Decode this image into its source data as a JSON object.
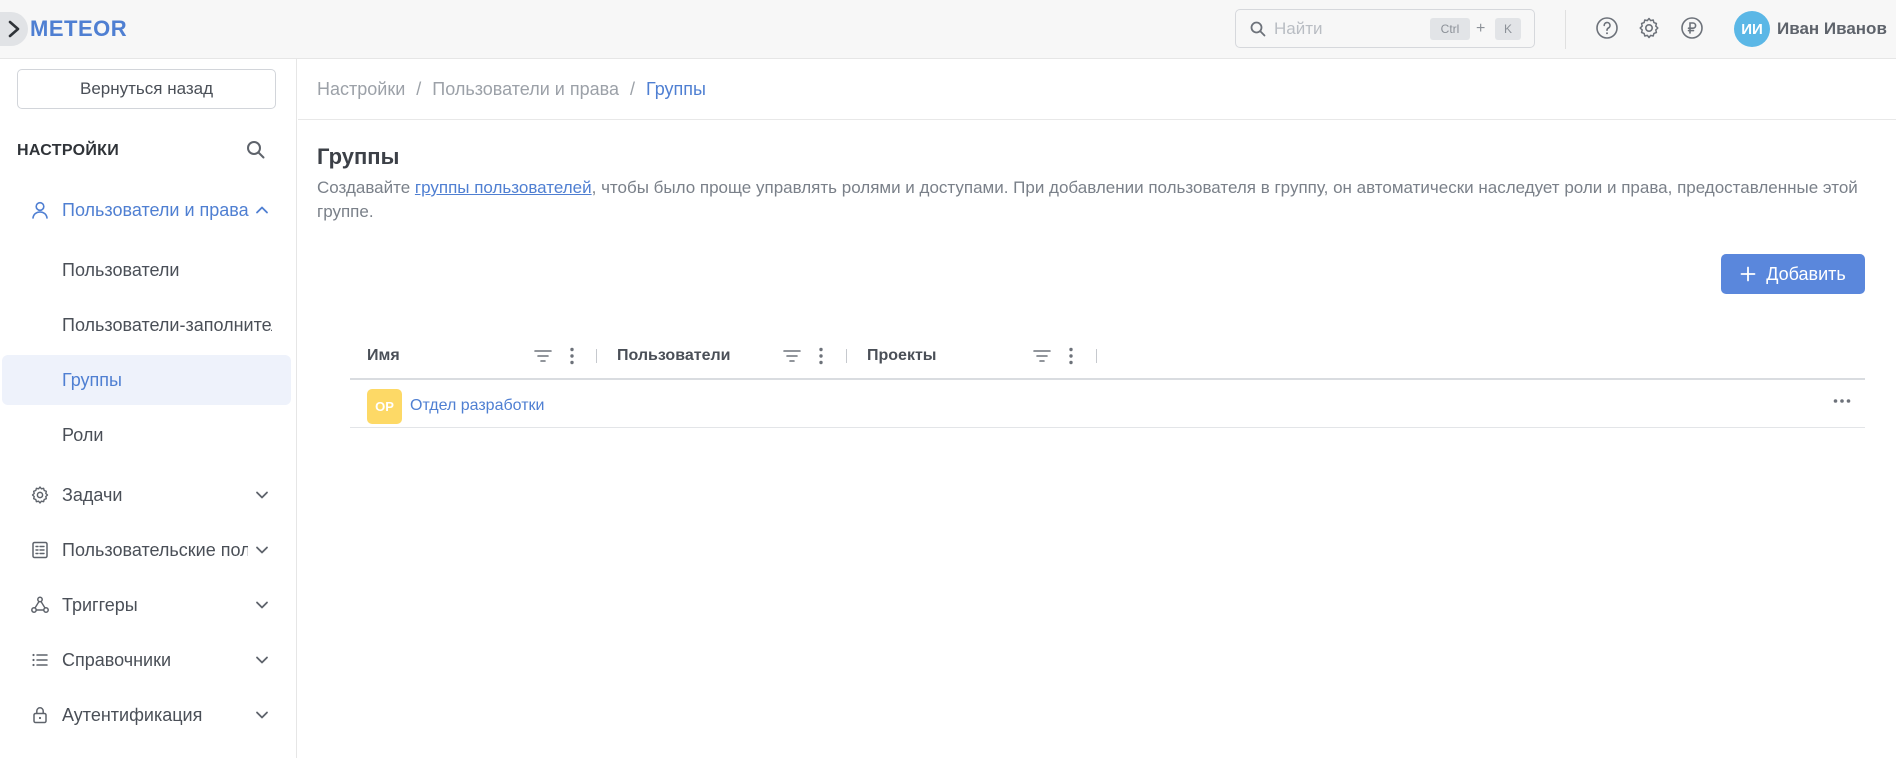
{
  "app": {
    "logo": "METEOR"
  },
  "header": {
    "search_placeholder": "Найти",
    "shortcut_ctrl": "Ctrl",
    "shortcut_plus": "+",
    "shortcut_key": "K",
    "user_initials": "ИИ",
    "user_name": "Иван Иванов",
    "icons": [
      "help-icon",
      "settings-icon",
      "currency-icon"
    ]
  },
  "sidebar": {
    "back_label": "Вернуться назад",
    "title": "НАСТРОЙКИ",
    "items": [
      {
        "label": "Пользователи и права",
        "icon": "user-icon",
        "expanded": true
      },
      {
        "label": "Пользователи"
      },
      {
        "label": "Пользователи-заполнители"
      },
      {
        "label": "Группы",
        "active": true
      },
      {
        "label": "Роли"
      },
      {
        "label": "Задачи",
        "icon": "gear-icon"
      },
      {
        "label": "Пользовательские поля",
        "icon": "list-icon"
      },
      {
        "label": "Триггеры",
        "icon": "trigger-icon"
      },
      {
        "label": "Справочники",
        "icon": "menu-list-icon"
      },
      {
        "label": "Аутентификация",
        "icon": "lock-icon"
      }
    ]
  },
  "breadcrumb": {
    "items": [
      "Настройки",
      "Пользователи и права",
      "Группы"
    ],
    "separator": "/"
  },
  "page": {
    "title": "Группы",
    "desc_before": "Создавайте ",
    "desc_link": "группы пользователей",
    "desc_after": ", чтобы было проще управлять ролями и доступами. При добавлении пользователя в группу, он автоматически наследует роли и права, предоставленные этой группе.",
    "add_label": "Добавить"
  },
  "table": {
    "columns": [
      "Имя",
      "Пользователи",
      "Проекты"
    ],
    "rows": [
      {
        "initials": "ОР",
        "name": "Отдел разработки"
      }
    ]
  },
  "colors": {
    "accent": "#5a87dc",
    "link": "#4f7fd2",
    "avatar_user": "#5bb7e6",
    "avatar_group": "#fdd966",
    "active_bg": "#eef2fb"
  }
}
